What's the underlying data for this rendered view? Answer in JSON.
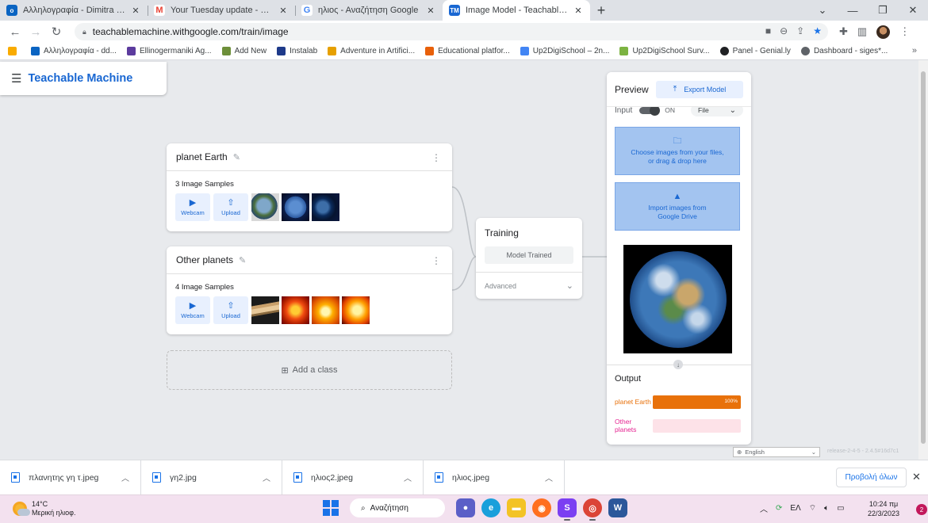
{
  "browser": {
    "tabs": [
      {
        "title": "Αλληλογραφία - Dimitra Dimitrai",
        "icon": "outlook-icon",
        "color": "#0a64c2",
        "glyph": "o",
        "active": false
      },
      {
        "title": "Your Tuesday update - Mein Arbe",
        "icon": "gmail-icon",
        "color": "#ea4335",
        "glyph": "M",
        "active": false
      },
      {
        "title": "ηλιος - Αναζήτηση Google",
        "icon": "google-icon",
        "color": "#4285f4",
        "glyph": "G",
        "active": false
      },
      {
        "title": "Image Model - Teachable Machin",
        "icon": "teachable-machine-icon",
        "color": "#1967d2",
        "glyph": "TM",
        "active": true
      }
    ],
    "url": "teachablemachine.withgoogle.com/train/image",
    "bookmarks": [
      {
        "label": "Αλληλογραφία - dd...",
        "color": "#0a64c2"
      },
      {
        "label": "Ellinogermaniki Ag...",
        "color": "#5c3b9e"
      },
      {
        "label": "Add New",
        "color": "#6d8f3a"
      },
      {
        "label": "Instalab",
        "color": "#1e3a8a"
      },
      {
        "label": "Adventure in Artifici...",
        "color": "#e6a000"
      },
      {
        "label": "Educational platfor...",
        "color": "#e8600a"
      },
      {
        "label": "Up2DigiSchool – 2n...",
        "color": "#4285f4"
      },
      {
        "label": "Up2DigiSchool Surv...",
        "color": "#7cb342"
      },
      {
        "label": "Panel - Genial.ly",
        "color": "#202124"
      },
      {
        "label": "Dashboard - siges*...",
        "color": "#5f6368"
      }
    ]
  },
  "app": {
    "brand": "Teachable Machine",
    "classes": [
      {
        "name": "planet Earth",
        "samples_label": "3 Image Samples",
        "thumbs": [
          "t-earth1",
          "t-earth2",
          "t-earth3"
        ]
      },
      {
        "name": "Other planets",
        "samples_label": "4 Image Samples",
        "thumbs": [
          "t-saturn",
          "t-sun1",
          "t-sun2",
          "t-sun3"
        ]
      }
    ],
    "webcam_label": "Webcam",
    "upload_label": "Upload",
    "add_class_label": "Add a class",
    "training": {
      "title": "Training",
      "button_label": "Model Trained",
      "advanced_label": "Advanced"
    },
    "preview": {
      "title": "Preview",
      "export_label": "Export Model",
      "input_label": "Input",
      "toggle_label": "ON",
      "source_value": "File",
      "choose_text_1": "Choose images from your files,",
      "choose_text_2": "or drag & drop here",
      "drive_text_1": "Import images from",
      "drive_text_2": "Google Drive",
      "output_title": "Output",
      "outputs": [
        {
          "label": "planet Earth",
          "value": 1.0,
          "pct_label": "100%",
          "color": "#e8710a",
          "track": "#fbe3cc"
        },
        {
          "label": "Other planets",
          "value": 0.0,
          "pct_label": "",
          "color": "#e52592",
          "track": "#fde2e8"
        }
      ]
    },
    "language": "English",
    "release": "release-2-4-5 - 2.4.5#16d7c1"
  },
  "downloads": {
    "items": [
      "πλανητης γη τ.jpeg",
      "γη2.jpg",
      "ηλιος2.jpeg",
      "ηλιος.jpeg"
    ],
    "show_all": "Προβολή όλων"
  },
  "taskbar": {
    "temp": "14°C",
    "weather": "Μερική ηλιοφ.",
    "search": "Αναζήτηση",
    "lang": "ΕΛ",
    "time": "10:24 πμ",
    "date": "22/3/2023",
    "notifications": "2"
  }
}
